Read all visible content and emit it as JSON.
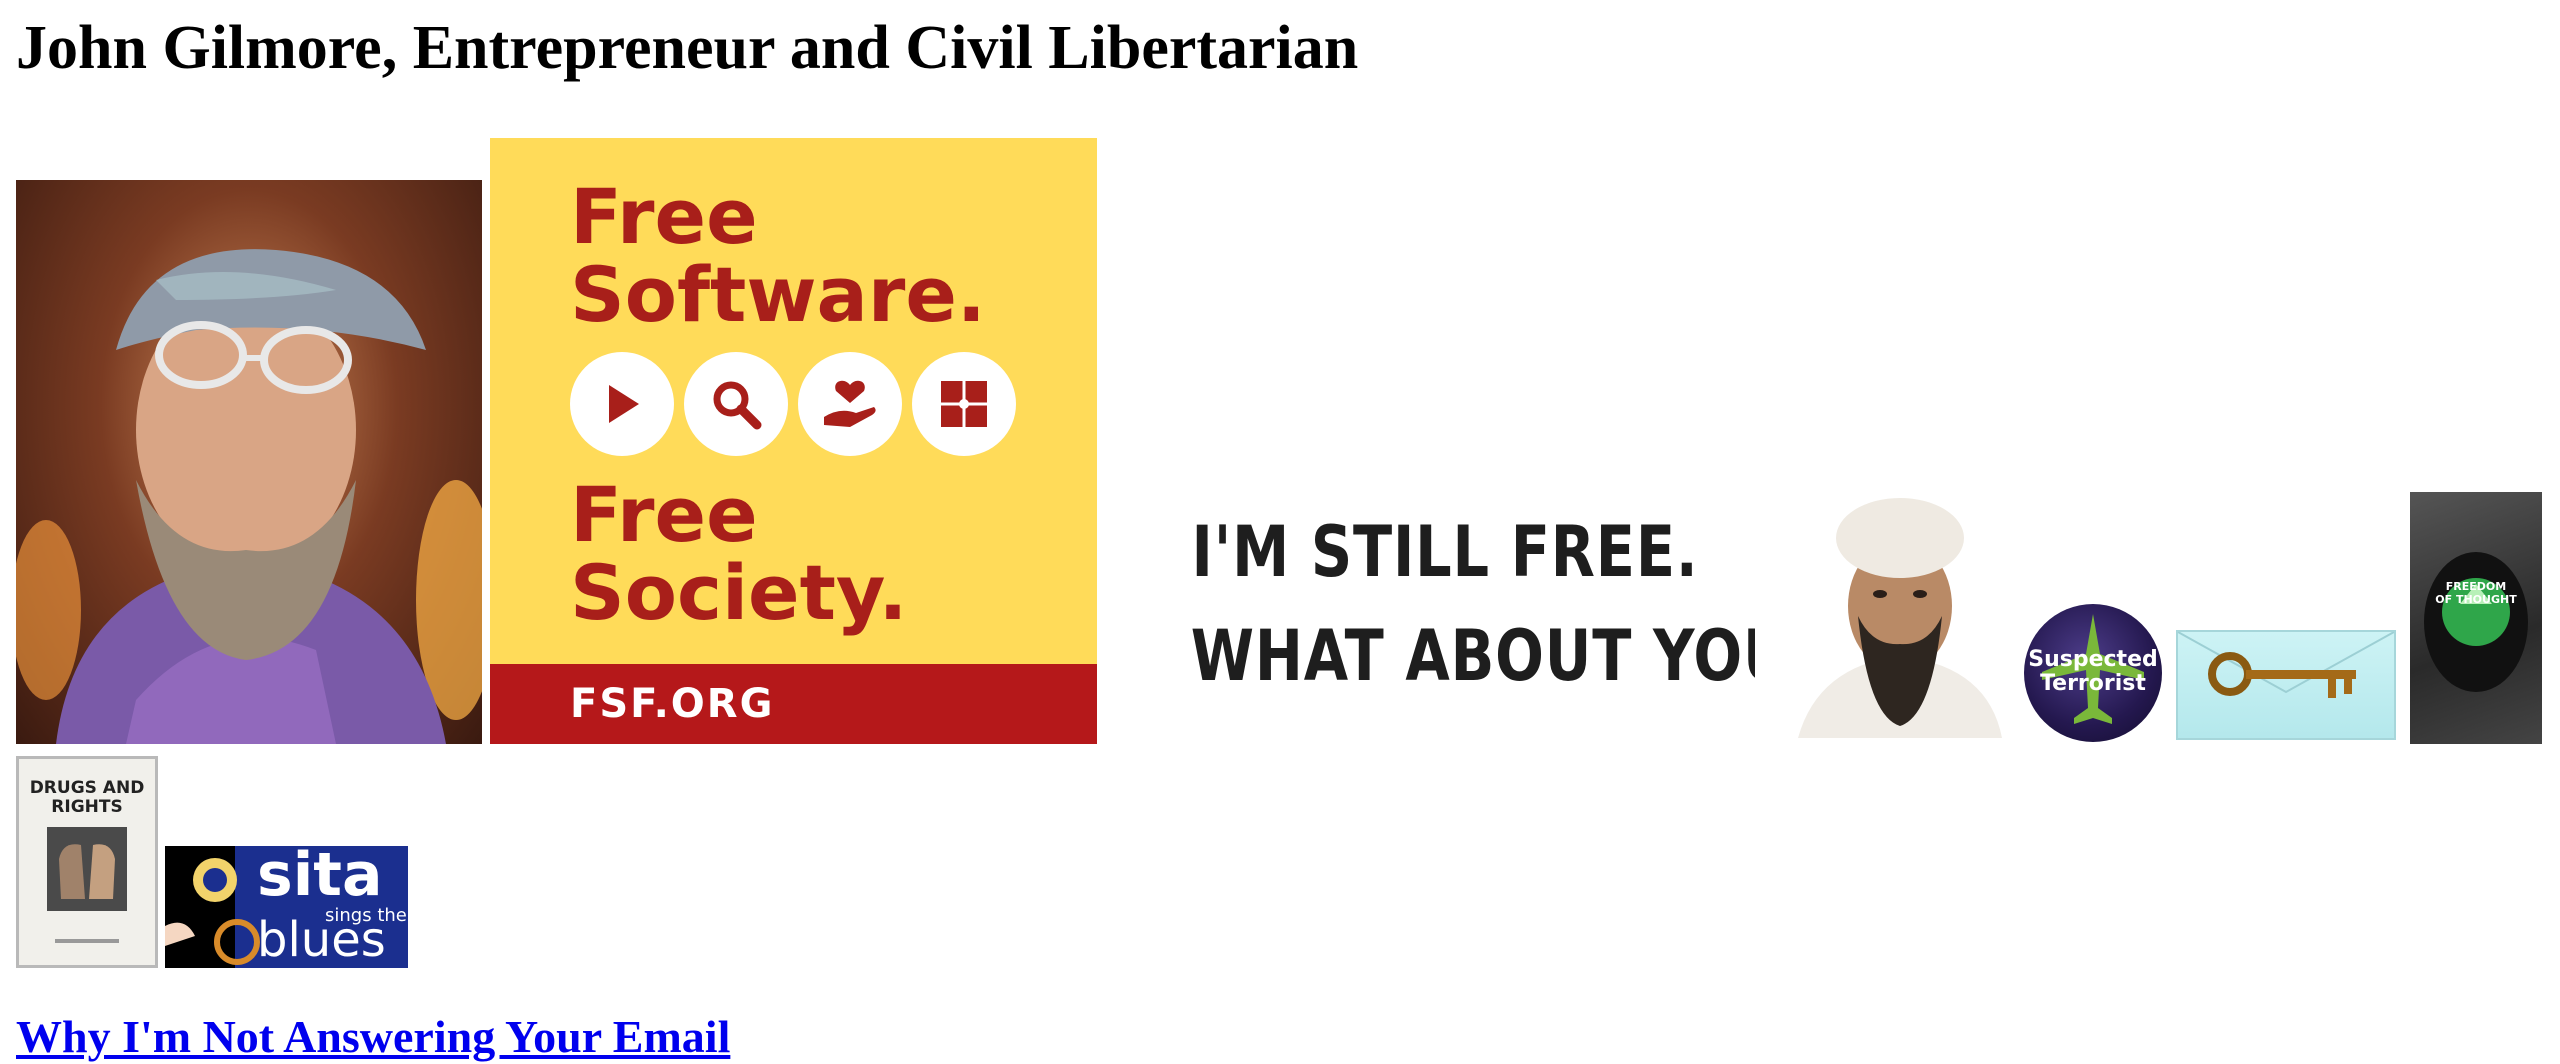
{
  "page": {
    "title": "John Gilmore, Entrepreneur and Civil Libertarian"
  },
  "images": {
    "portrait": {
      "icon": "portrait-photo"
    },
    "fsf_banner": {
      "line1": "Free\nSoftware.",
      "line2": "Free\nSociety.",
      "footer": "FSF.ORG",
      "icons": [
        "play-icon",
        "search-icon",
        "heart-hand-icon",
        "puzzle-icon"
      ],
      "colors": {
        "background": "#ffdb59",
        "accent": "#a81f1a",
        "footer": "#b5181a"
      }
    },
    "still_free": {
      "line1": "I'M STILL FREE.",
      "line2": "WHAT ABOUT YOU?"
    },
    "turban_portrait": {
      "icon": "portrait-photo"
    },
    "terrorist_badge": {
      "line1": "Suspected",
      "line2": "Terrorist"
    },
    "envelope": {
      "icon": "key-icon"
    },
    "keychain": {
      "line1": "FREEDOM",
      "line2": "OF THOUGHT"
    },
    "book_cover": {
      "title": "DRUGS AND\nRIGHTS"
    },
    "sita_banner": {
      "word1": "sita",
      "word2": "sings the",
      "word3": "blues"
    }
  },
  "links": {
    "email": "Why I'm Not Answering Your Email"
  }
}
